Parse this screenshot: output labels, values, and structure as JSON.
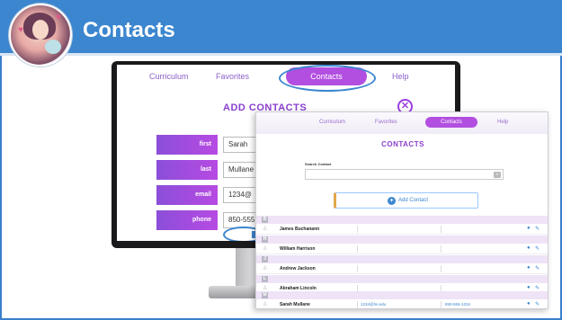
{
  "slide": {
    "title": "Contacts"
  },
  "colors": {
    "title_bar": "#3b86cf",
    "accent_purple": "#b24fe0",
    "highlight_ring": "#3b86cf"
  },
  "icons": {
    "avatar": "mother-with-baby-illustration",
    "close": "close-circle-icon",
    "search": "search-icon",
    "add": "plus-circle-icon",
    "person": "person-icon",
    "view": "eye-icon",
    "edit": "pencil-icon"
  },
  "back_app": {
    "nav": {
      "curriculum": "Curriculum",
      "favorites": "Favorites",
      "contacts": "Contacts",
      "help": "Help"
    },
    "heading": "ADD CONTACTS",
    "close_symbol": "✕",
    "fields": [
      {
        "label": "first",
        "value": "Sarah"
      },
      {
        "label": "last",
        "value": "Mullane"
      },
      {
        "label": "email",
        "value": "1234@"
      },
      {
        "label": "phone",
        "value": "850-555"
      }
    ]
  },
  "front_app": {
    "nav": {
      "curriculum": "Curriculum",
      "favorites": "Favorites",
      "contacts": "Contacts",
      "help": "Help"
    },
    "heading": "CONTACTS",
    "search_label": "Search Contact",
    "search_placeholder": "",
    "add_button": "Add Contact",
    "add_symbol": "+",
    "letters": [
      "B",
      "H",
      "J",
      "L",
      "M"
    ],
    "contacts": [
      {
        "name": "James Buchanann",
        "email": "",
        "phone": ""
      },
      {
        "name": "William Harrison",
        "email": "",
        "phone": ""
      },
      {
        "name": "Andrew Jackson",
        "email": "",
        "phone": ""
      },
      {
        "name": "Abraham Lincoln",
        "email": "",
        "phone": ""
      },
      {
        "name": "Sarah Mullane",
        "email": "1234@hs.edu",
        "phone": "850-555-1234"
      }
    ]
  }
}
